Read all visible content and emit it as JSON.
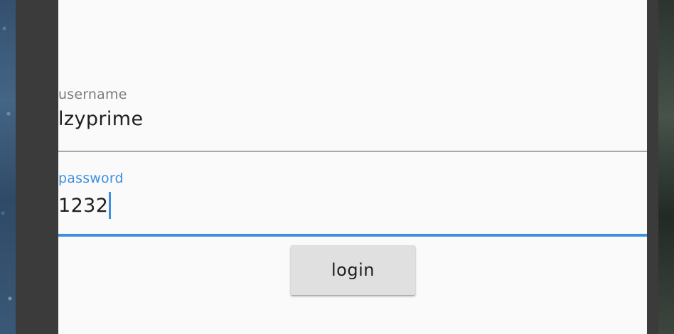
{
  "form": {
    "username": {
      "label": "username",
      "value": "lzyprime"
    },
    "password": {
      "label": "password",
      "value": "1232"
    },
    "login_label": "login"
  },
  "colors": {
    "accent": "#3d8fe0",
    "surface": "#fafafa",
    "frame": "#3b3b3b",
    "button": "#e0e0e0"
  }
}
